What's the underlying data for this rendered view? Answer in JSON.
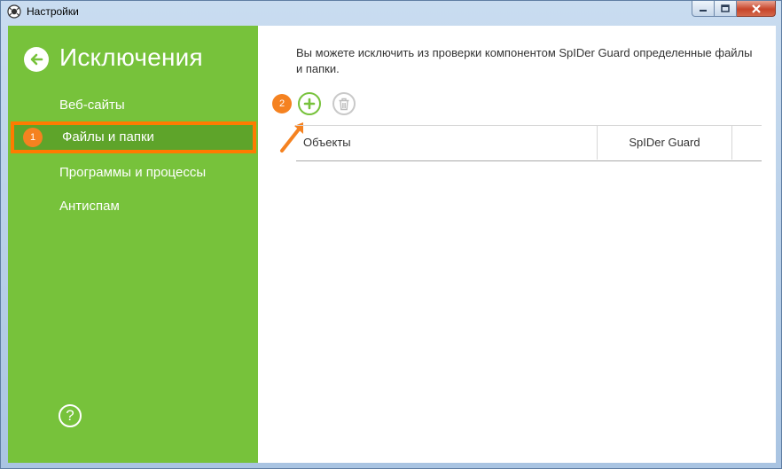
{
  "window": {
    "title": "Настройки"
  },
  "sidebar": {
    "title": "Исключения",
    "items": [
      {
        "label": "Веб-сайты"
      },
      {
        "label": "Файлы и папки",
        "badge": "1"
      },
      {
        "label": "Программы и процессы"
      },
      {
        "label": "Антиспам"
      }
    ],
    "help_label": "?"
  },
  "main": {
    "description": "Вы можете исключить из проверки компонентом SpIDer Guard определенные файлы и папки.",
    "toolbar_badge": "2",
    "table": {
      "columns": [
        "Объекты",
        "SpIDer Guard"
      ]
    }
  },
  "colors": {
    "sidebar_bg": "#77c23b",
    "selected_bg": "#5ea42a",
    "highlight": "#ff7b00",
    "badge": "#f58220"
  },
  "icons": [
    "app-logo-icon",
    "minimize-icon",
    "maximize-icon",
    "close-icon",
    "back-arrow-icon",
    "add-icon",
    "delete-trash-icon",
    "help-icon",
    "pointer-arrow-icon"
  ]
}
